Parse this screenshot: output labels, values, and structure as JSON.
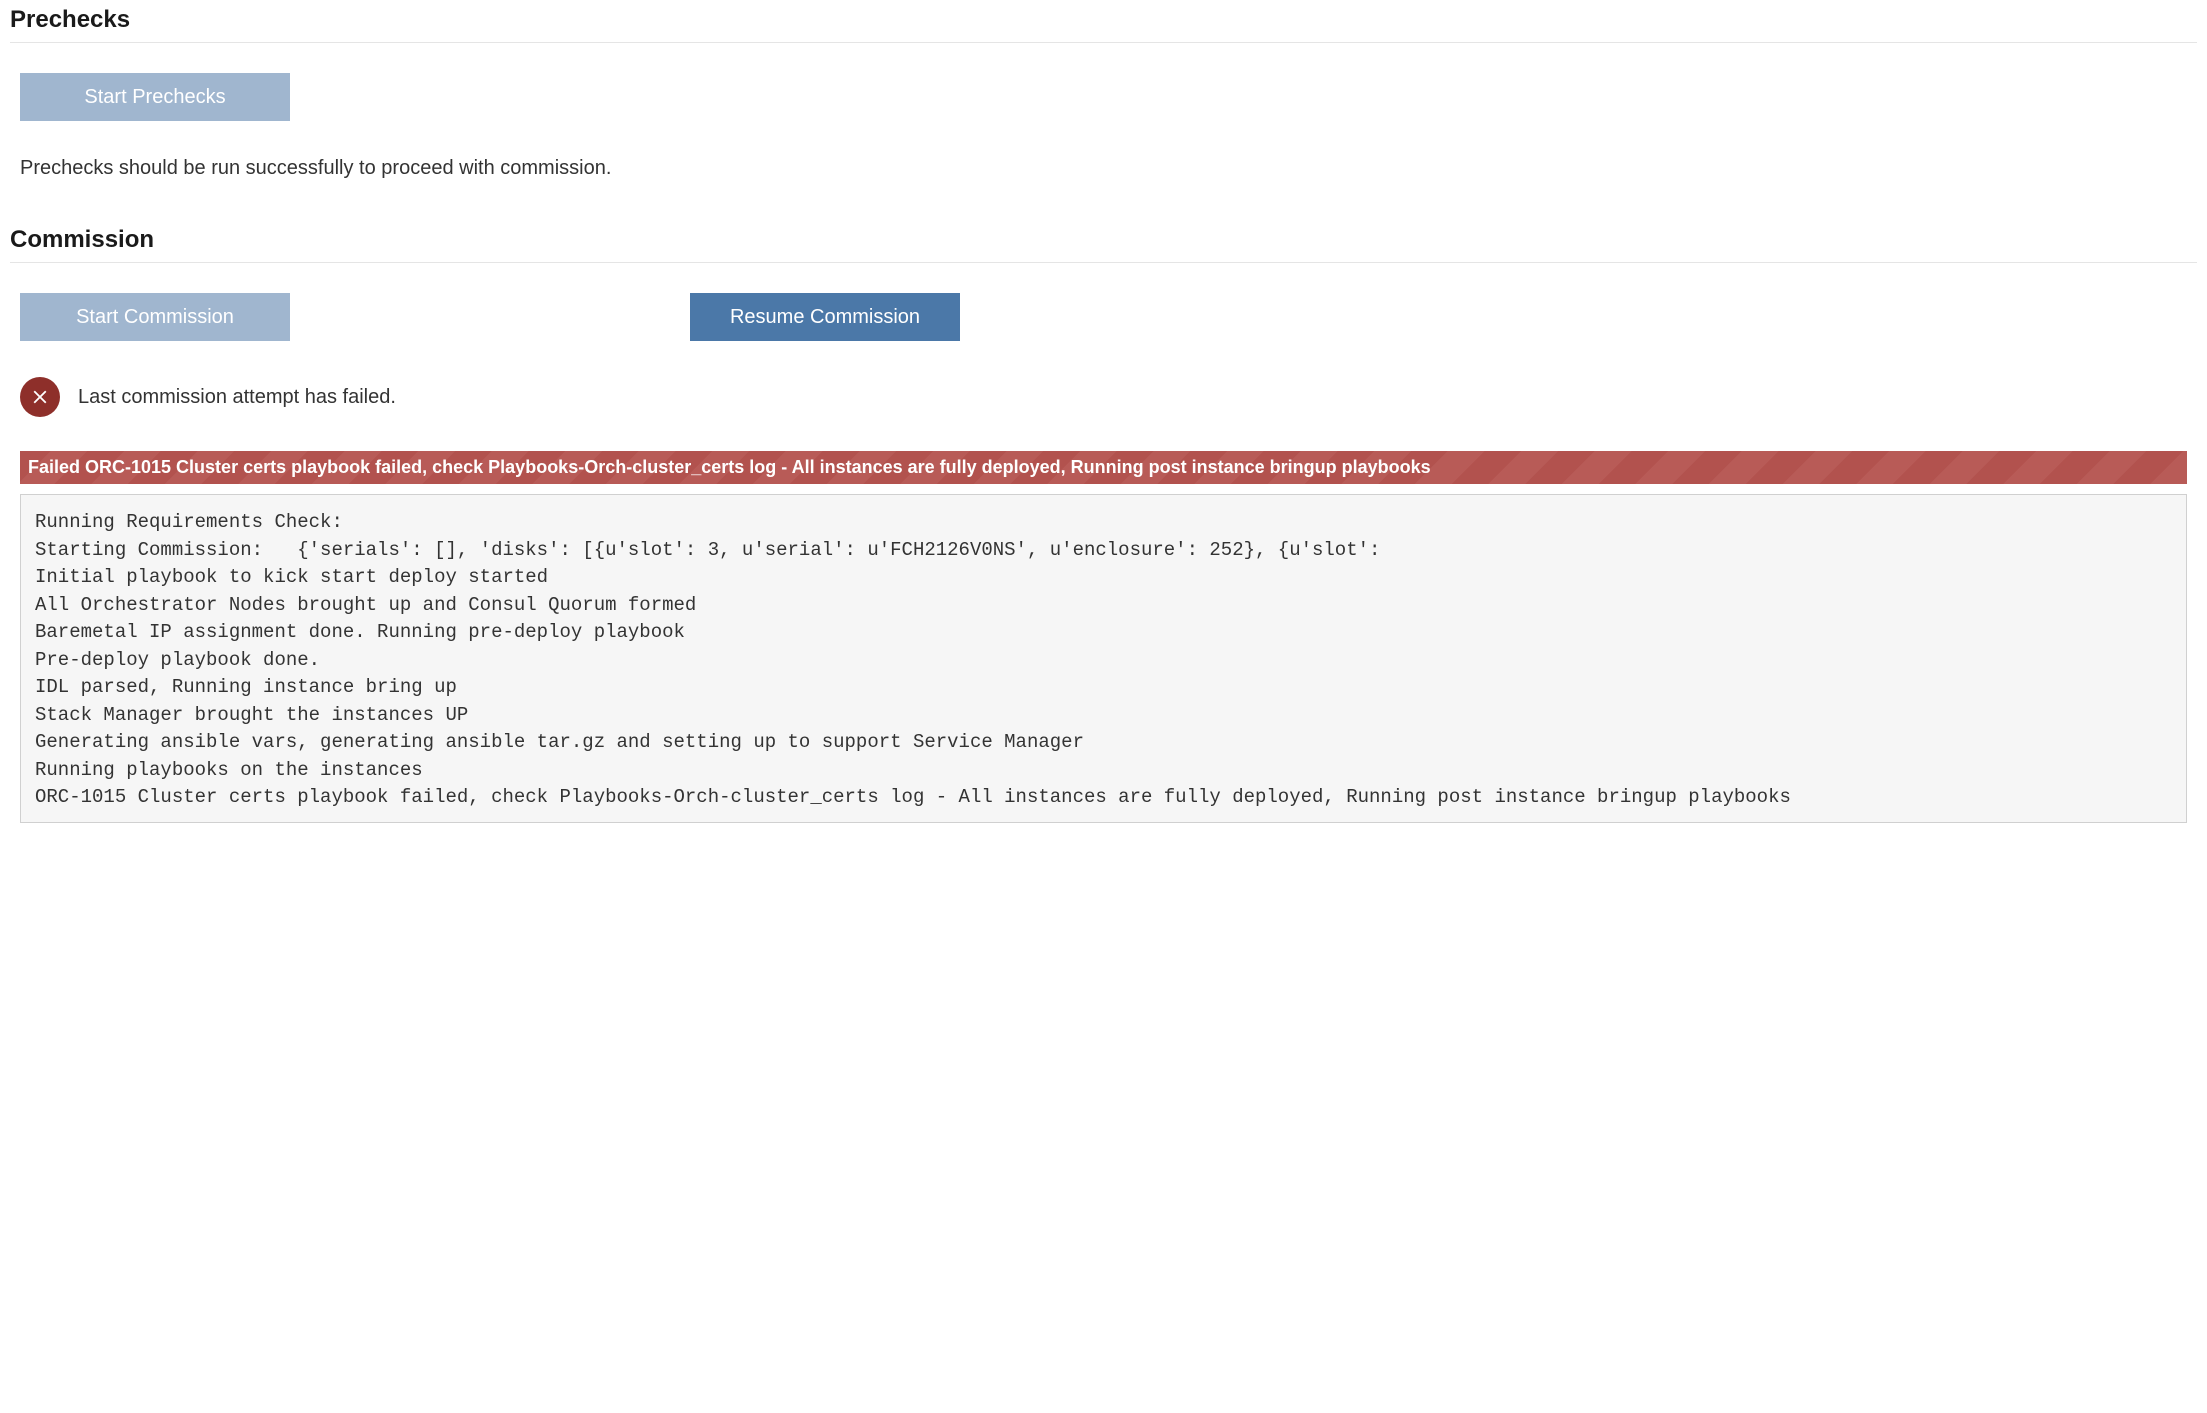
{
  "prechecks": {
    "title": "Prechecks",
    "start_button": "Start Prechecks",
    "info": "Prechecks should be run successfully to proceed with commission."
  },
  "commission": {
    "title": "Commission",
    "start_button": "Start Commission",
    "resume_button": "Resume Commission",
    "status_text": "Last commission attempt has failed.",
    "error_banner": "Failed ORC-1015 Cluster certs playbook failed, check Playbooks-Orch-cluster_certs log - All instances are fully deployed, Running post instance bringup playbooks",
    "log_lines": [
      "Running Requirements Check:",
      "Starting Commission:   {'serials': [], 'disks': [{u'slot': 3, u'serial': u'FCH2126V0NS', u'enclosure': 252}, {u'slot':",
      "Initial playbook to kick start deploy started",
      "All Orchestrator Nodes brought up and Consul Quorum formed",
      "Baremetal IP assignment done. Running pre-deploy playbook",
      "Pre-deploy playbook done.",
      "IDL parsed, Running instance bring up",
      "Stack Manager brought the instances UP",
      "Generating ansible vars, generating ansible tar.gz and setting up to support Service Manager",
      "Running playbooks on the instances",
      "ORC-1015 Cluster certs playbook failed, check Playbooks-Orch-cluster_certs log - All instances are fully deployed, Running post instance bringup playbooks"
    ]
  }
}
